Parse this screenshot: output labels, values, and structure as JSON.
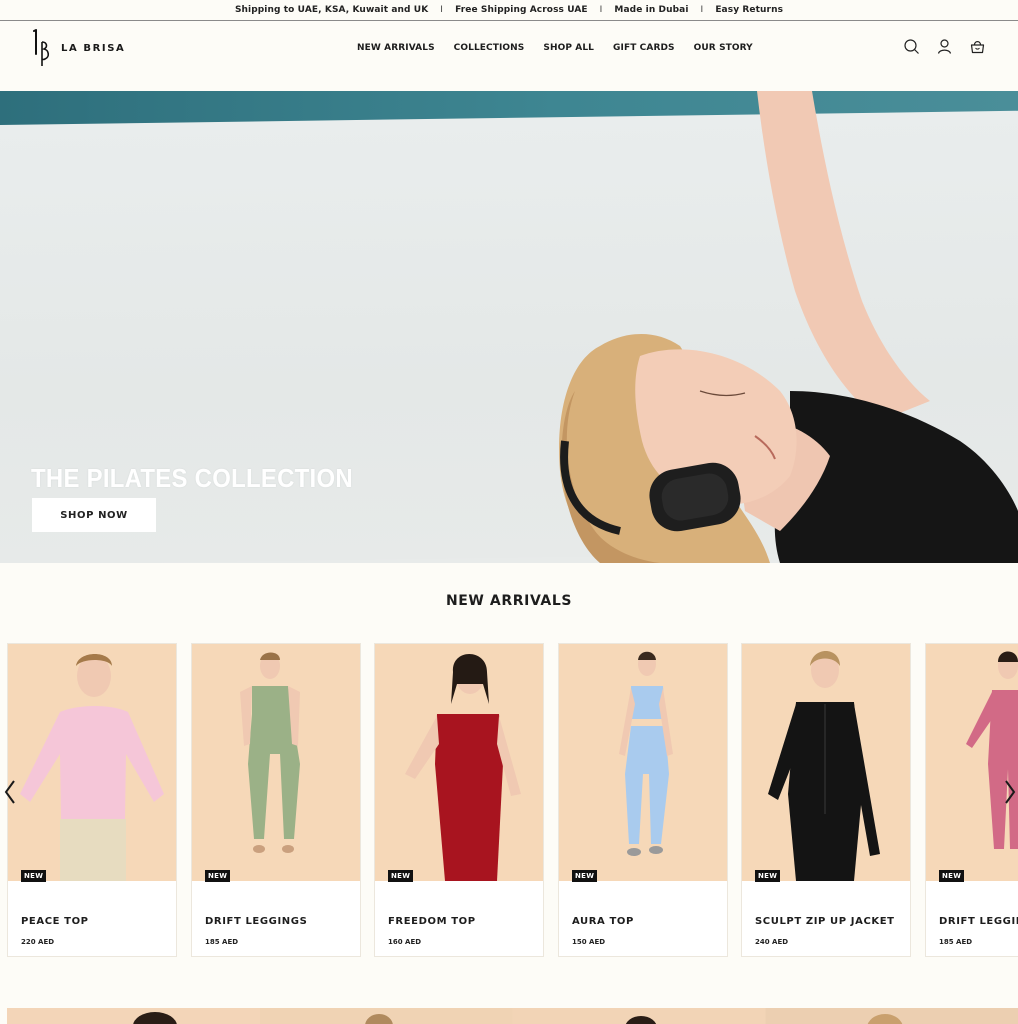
{
  "announcement": {
    "items": [
      "Shipping to UAE, KSA, Kuwait and UK",
      "Free Shipping Across UAE",
      "Made in Dubai",
      "Easy Returns"
    ],
    "separator": "I"
  },
  "brand": {
    "name": "LA BRISA"
  },
  "nav": [
    {
      "label": "NEW ARRIVALS"
    },
    {
      "label": "COLLECTIONS"
    },
    {
      "label": "SHOP ALL"
    },
    {
      "label": "GIFT CARDS"
    },
    {
      "label": "OUR STORY"
    }
  ],
  "header_icons": [
    "search-icon",
    "account-icon",
    "cart-icon"
  ],
  "hero": {
    "title": "THE PILATES COLLECTION",
    "cta": "SHOP NOW"
  },
  "new_arrivals": {
    "title": "NEW ARRIVALS",
    "products": [
      {
        "badge": "NEW",
        "name": "PEACE TOP",
        "price": "220 AED",
        "color": "#f5c6d8",
        "accent": "#d9d4b3"
      },
      {
        "badge": "NEW",
        "name": "DRIFT LEGGINGS",
        "price": "185 AED",
        "color": "#9bb187",
        "accent": "#9bb187"
      },
      {
        "badge": "NEW",
        "name": "FREEDOM TOP",
        "price": "160 AED",
        "color": "#a8141f",
        "accent": "#b01c24"
      },
      {
        "badge": "NEW",
        "name": "AURA TOP",
        "price": "150 AED",
        "color": "#a9cbee",
        "accent": "#a9cbee"
      },
      {
        "badge": "NEW",
        "name": "SCULPT ZIP UP JACKET",
        "price": "240 AED",
        "color": "#141414",
        "accent": "#141414"
      },
      {
        "badge": "NEW",
        "name": "DRIFT LEGGINGS",
        "price": "185 AED",
        "color": "#d26a86",
        "accent": "#d26a86"
      }
    ]
  },
  "colors": {
    "background": "#fdfcf7",
    "card_photo_bg": "#f6d8b8",
    "badge_bg": "#111111",
    "hero_teal": "#3e8692"
  }
}
